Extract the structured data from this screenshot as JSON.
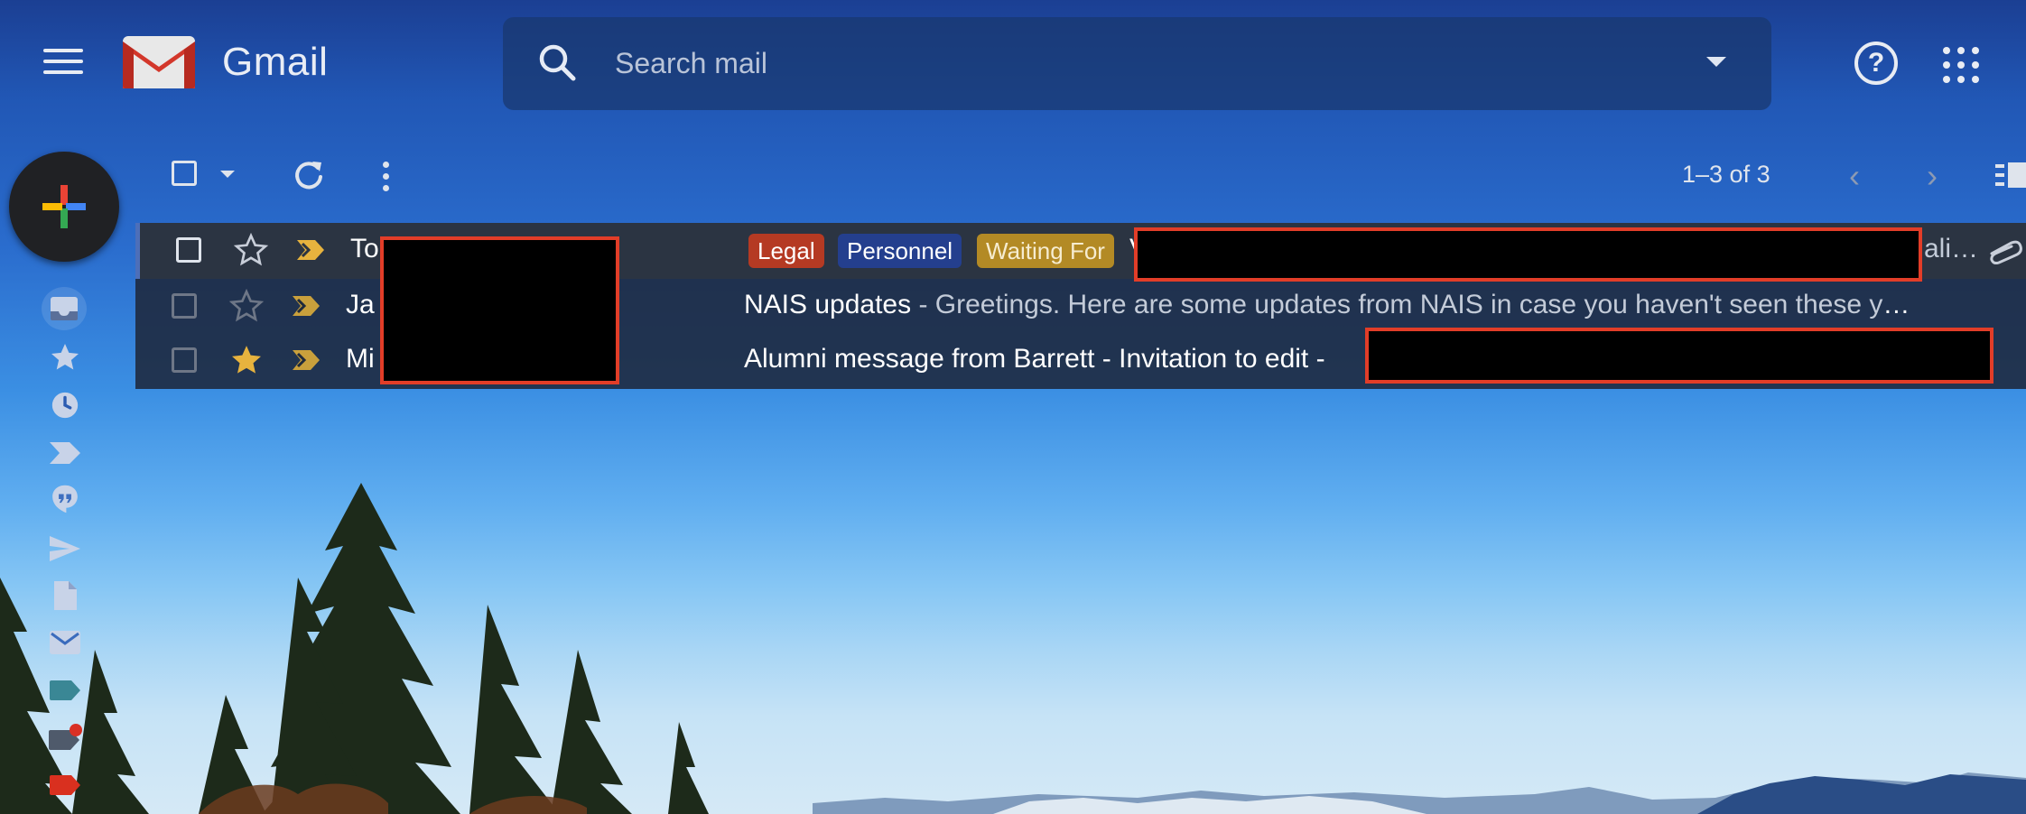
{
  "app": {
    "name": "Gmail"
  },
  "search": {
    "placeholder": "Search mail"
  },
  "toolbar": {
    "count_text": "1–3 of 3"
  },
  "icons": {
    "menu": "hamburger-menu-icon",
    "search": "search-icon",
    "help": "help-icon",
    "apps": "apps-grid-icon",
    "refresh": "refresh-icon",
    "more": "more-vert-icon",
    "prev": "chevron-left-icon",
    "next": "chevron-right-icon"
  },
  "help": {
    "glyph": "?"
  },
  "nav": {
    "prev_glyph": "‹",
    "next_glyph": "›"
  },
  "sidebar": {
    "items": [
      {
        "icon": "inbox-icon",
        "active": true
      },
      {
        "icon": "starred-icon"
      },
      {
        "icon": "snoozed-icon"
      },
      {
        "icon": "important-icon"
      },
      {
        "icon": "chats-icon"
      },
      {
        "icon": "sent-icon"
      },
      {
        "icon": "drafts-icon"
      },
      {
        "icon": "all-mail-icon"
      },
      {
        "icon": "label-teal-icon"
      },
      {
        "icon": "label-gray-icon"
      },
      {
        "icon": "label-red-icon"
      }
    ]
  },
  "emails": [
    {
      "sender": "To",
      "labels": [
        "Legal",
        "Personnel",
        "Waiting For"
      ],
      "subject_start": "V",
      "tail": "ali…",
      "starred": false,
      "has_attachment": true
    },
    {
      "sender": "Ja",
      "subject": "NAIS updates",
      "snippet": " - Greetings. Here are some updates from NAIS in case you haven't seen these ye…",
      "starred": false
    },
    {
      "sender": "Mi",
      "subject": "Alumni message from Barrett - Invitation to edit -",
      "starred": true
    }
  ],
  "colors": {
    "label_legal": "#b53a23",
    "label_personnel": "#243f8e",
    "label_waiting": "#b38a25",
    "star_filled": "#e7b33e",
    "important": "#e7b33e",
    "redaction_border": "#e23d28"
  }
}
